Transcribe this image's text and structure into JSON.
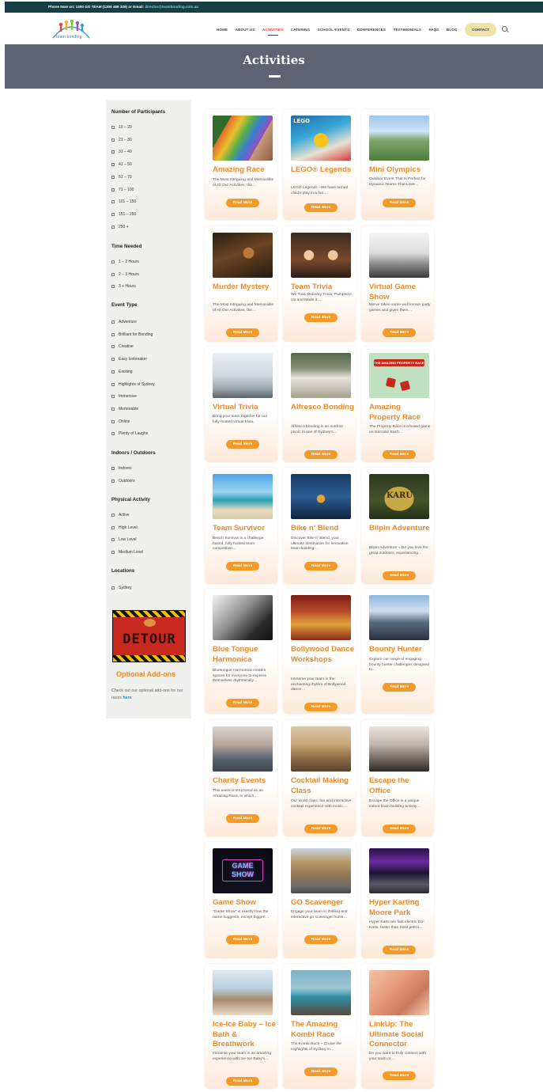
{
  "topbar": {
    "phone_text": "Phone Now on: 1300 GO TEAM (1300 468 326) or Email: ",
    "email": "director@teambonding.com.au"
  },
  "header": {
    "logo_text": "team bonding",
    "nav": [
      "HOME",
      "ABOUT US",
      "ACTIVITIES",
      "CATERING",
      "SCHOOL EVENTS",
      "CONFERENCES",
      "TESTIMONIALS",
      "FAQS",
      "BLOG"
    ],
    "active_nav": "ACTIVITIES",
    "contact_label": "CONTACT",
    "search_icon": "search-icon"
  },
  "hero": {
    "title": "Activities"
  },
  "sidebar": {
    "groups": [
      {
        "title": "Number of Participants",
        "options": [
          "10 – 20",
          "21 – 30",
          "31 – 40",
          "41 – 50",
          "51 – 70",
          "71 – 100",
          "101 – 150",
          "151 – 250",
          "250 +"
        ]
      },
      {
        "title": "Time Needed",
        "options": [
          "1 – 2 Hours",
          "2 – 3 Hours",
          "3 + Hours"
        ]
      },
      {
        "title": "Event Type",
        "options": [
          "Adventure",
          "Brilliant for Bonding",
          "Creative",
          "Easy Icebreaker",
          "Exciting",
          "Highlights of Sydney",
          "Immersive",
          "Memorable",
          "Online",
          "Plenty of Laughs"
        ]
      },
      {
        "title": "Indoors / Outdoors",
        "options": [
          "Indoors",
          "Outdoors"
        ]
      },
      {
        "title": "Physical Activity",
        "options": [
          "Active",
          "High Level",
          "Low Level",
          "Medium Level"
        ]
      },
      {
        "title": "Locations",
        "options": [
          "Sydney"
        ]
      }
    ],
    "addon_image_text": "DETOUR",
    "addon_title": "Optional Add-ons",
    "addon_text": "Check out our optional add-ons for our races ",
    "addon_link": "here"
  },
  "cards": [
    {
      "title": "Amazing Race",
      "excerpt": "The Most Intriguing and Memorable of All Our Activities, the…",
      "button": "Read More"
    },
    {
      "title": "LEGO® Legends",
      "excerpt": "LEGO Legends –We have turned child's play in a fun…",
      "button": "Read More"
    },
    {
      "title": "Mini Olympics",
      "excerpt": "Outdoor Event That Is Perfect for Dynamic Teams That Love…",
      "button": "Read More"
    },
    {
      "title": "Murder Mystery",
      "excerpt": "The Most Intriguing and Memorable of All Our Activities, the…",
      "button": "Read More"
    },
    {
      "title": "Team Trivia",
      "excerpt": "We Took Ordinary Trivia, Pumped it Up and Made it…",
      "button": "Read More"
    },
    {
      "title": "Virtual Game Show",
      "excerpt": "We've taken some well known party games and given them…",
      "button": "Read More"
    },
    {
      "title": "Virtual Trivia",
      "excerpt": "Bring your team together for our fully-hosted virtual trivia.",
      "button": "Read More"
    },
    {
      "title": "Alfresco Bonding",
      "excerpt": "Alfresco bonding is an outdoor picnic in one of Sydney's…",
      "button": "Read More"
    },
    {
      "title": "Amazing Property Race",
      "excerpt": "The Property Race is a board game on steroids! Each…",
      "button": "Read More"
    },
    {
      "title": "Team Survivor",
      "excerpt": "Beach Survivor is a challenge based, fully hosted team competition…",
      "button": "Read More"
    },
    {
      "title": "Bike n' Blend",
      "excerpt": "Discover Bike n' Blend, your ultimate destination for innovative team-building…",
      "button": "Read More"
    },
    {
      "title": "Bilpin Adventure",
      "excerpt": "Bilpin Adventure – Do you love the great outdoors, experiencing…",
      "button": "Read More"
    },
    {
      "title": "Blue Tongue Harmonica",
      "excerpt": "Bluetongue Harmonica creates spaces for everyone to express themselves rhythmically…",
      "button": "Read More"
    },
    {
      "title": "Bollywood Dance Workshops",
      "excerpt": "Immerse your team in the enchanting rhythm of Bollywood dance…",
      "button": "Read More"
    },
    {
      "title": "Bounty Hunter",
      "excerpt": "Explore our range of engaging bounty hunter challenges designed to…",
      "button": "Read More"
    },
    {
      "title": "Charity Events",
      "excerpt": "This event is structured as an Amazing Race, in which…",
      "button": "Read More"
    },
    {
      "title": "Cocktail Making Class",
      "excerpt": "Our world class, fun and interactive cocktail experience with music,…",
      "button": "Read More"
    },
    {
      "title": "Escape the Office",
      "excerpt": "Escape the Office is a unique indoor team building activity…",
      "button": "Read More"
    },
    {
      "title": "Game Show",
      "excerpt": "\"Game Show\" is exactly how the name suggests, except bigger!…",
      "button": "Read More"
    },
    {
      "title": "GO Scavenger",
      "excerpt": "Engage your team in thrilling and interactive go scavenger hunts…",
      "button": "Read More"
    },
    {
      "title": "Hyper Karting Moore Park",
      "excerpt": "Hyper Karts are fast electric Go-Karts, faster than most petrol…",
      "button": "Read More"
    },
    {
      "title": "Ice-Ice Baby – Ice Bath & Breathwork",
      "excerpt": "Immerse your team in an amazing experience with Ice-Ice Baby's…",
      "button": "Read More"
    },
    {
      "title": "The Amazing Kombi Race",
      "excerpt": "The Kombi Race – Cruise the Highlights of Sydney in…",
      "button": "Read More"
    },
    {
      "title": "LinkUp: The Ultimate Social Connector",
      "excerpt": "Do you want to truly connect with your team or…",
      "button": "Read More"
    }
  ],
  "card_image_text": {
    "lego": "LEGO",
    "property": "THE AMAZING PROPERTY RACE",
    "karu": "KARU",
    "gameshow": "GAME SHOW"
  },
  "colors": {
    "accent": "#ef8a2b",
    "button": "#f39a2a",
    "hero": "#5e6272",
    "topbar": "#163e44",
    "active_nav": "#d53b3b"
  }
}
